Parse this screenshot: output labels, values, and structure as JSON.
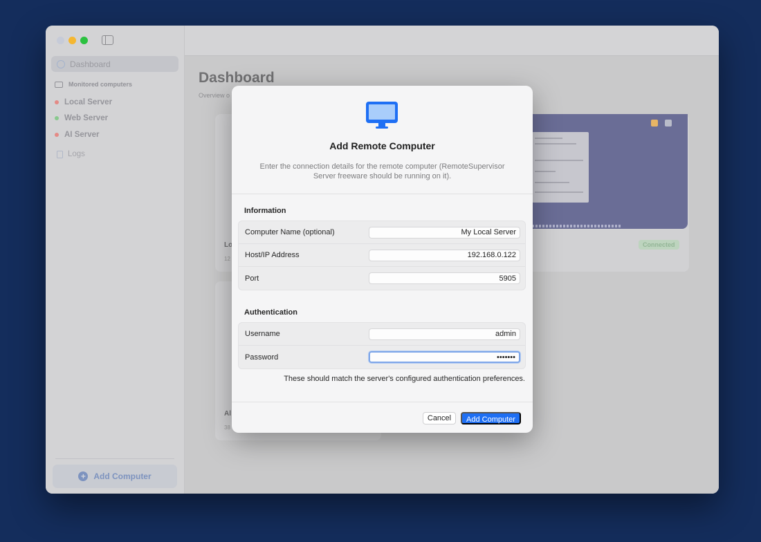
{
  "sidebar": {
    "dashboard_label": "Dashboard",
    "section_header": "Monitored computers",
    "servers": [
      {
        "name": "Local Server",
        "status_color": "#e48a86"
      },
      {
        "name": "Web Server",
        "status_color": "#89c98e"
      },
      {
        "name": "AI Server",
        "status_color": "#e48a86"
      }
    ],
    "logs_label": "Logs",
    "add_button_label": "Add Computer"
  },
  "main": {
    "title": "Dashboard",
    "subtitle_fragment": "Overview o",
    "card_labels": [
      "Lo",
      "Al"
    ],
    "card_subs": [
      "12",
      "38"
    ],
    "connected_badge": "Connected"
  },
  "modal": {
    "title": "Add Remote Computer",
    "description": "Enter the connection details for the remote computer (RemoteSupervisor Server freeware should be running on it).",
    "information_title": "Information",
    "information_fields": [
      {
        "label": "Computer Name (optional)",
        "value": "My Local Server"
      },
      {
        "label": "Host/IP Address",
        "value": "192.168.0.122"
      },
      {
        "label": "Port",
        "value": "5905"
      }
    ],
    "authentication_title": "Authentication",
    "auth_fields": [
      {
        "label": "Username",
        "value": "admin"
      },
      {
        "label": "Password",
        "value": "•••••••"
      }
    ],
    "hint": "These should match the server's configured authentication preferences.",
    "cancel_label": "Cancel",
    "primary_label": "Add Computer"
  },
  "colors": {
    "accent": "#1e6ff4",
    "background": "#142d5c",
    "traffic_close": "#c6cbd8",
    "traffic_minimize": "#f5b731",
    "traffic_zoom": "#2bc140"
  }
}
